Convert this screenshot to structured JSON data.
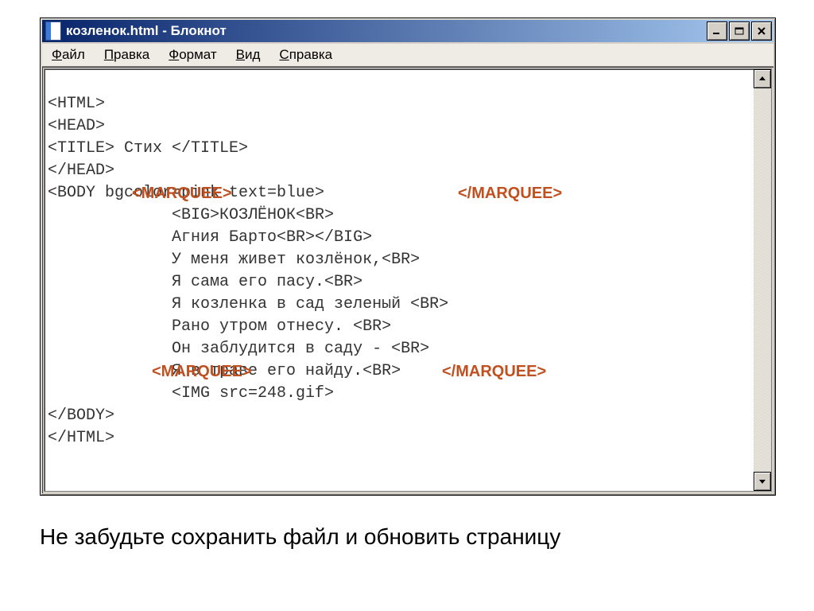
{
  "window": {
    "title": "козленок.html - Блокнот"
  },
  "menu": {
    "items": [
      {
        "u": "Ф",
        "rest": "айл"
      },
      {
        "u": "П",
        "rest": "равка"
      },
      {
        "u": "Ф",
        "rest": "ормат"
      },
      {
        "u": "В",
        "rest": "ид"
      },
      {
        "u": "С",
        "rest": "правка"
      }
    ]
  },
  "code": {
    "lines": [
      "<HTML>",
      "<HEAD>",
      "<TITLE> Стих </TITLE>",
      "</HEAD>",
      "<BODY bgcolor=pink text=blue>",
      "             <BIG>КОЗЛЁНОК<BR>",
      "             Агния Барто<BR></BIG>",
      "             У меня живет козлёнок,<BR>",
      "             Я сама его пасу.<BR>",
      "             Я козленка в сад зеленый <BR>",
      "             Рано утром отнесу. <BR>",
      "             Он заблудится в саду - <BR>",
      "             Я в траве его найду.<BR>",
      "             <IMG src=248.gif>",
      "</BODY>",
      "</HTML>"
    ]
  },
  "annotations": {
    "m_open_1": "<MARQUEE>",
    "m_close_1": "</MARQUEE>",
    "m_open_2": "<MARQUEE>",
    "m_close_2": "</MARQUEE>"
  },
  "caption": "Не забудьте сохранить файл и обновить страницу"
}
